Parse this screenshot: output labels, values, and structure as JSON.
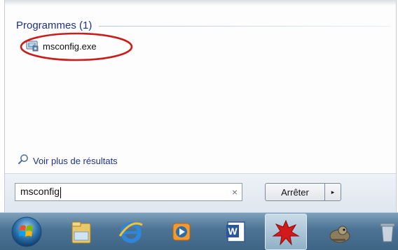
{
  "search_results": {
    "group_title": "Programmes (1)",
    "items": [
      {
        "label": "msconfig.exe",
        "icon": "msconfig-app-icon"
      }
    ],
    "see_more_label": "Voir plus de résultats"
  },
  "search": {
    "value": "msconfig",
    "clear_glyph": "×"
  },
  "buttons": {
    "stop_label": "Arrêter",
    "arrow_glyph": "▸"
  },
  "annotation": {
    "ellipse_color": "#cc1b1b"
  },
  "taskbar": {
    "items": [
      {
        "name": "start-orb-icon"
      },
      {
        "name": "file-explorer-icon"
      },
      {
        "name": "internet-explorer-icon"
      },
      {
        "name": "media-player-icon"
      },
      {
        "name": "word-icon"
      },
      {
        "name": "red-splat-app-icon",
        "active": true
      },
      {
        "name": "gimp-icon"
      },
      {
        "name": "recycle-icon"
      }
    ]
  }
}
